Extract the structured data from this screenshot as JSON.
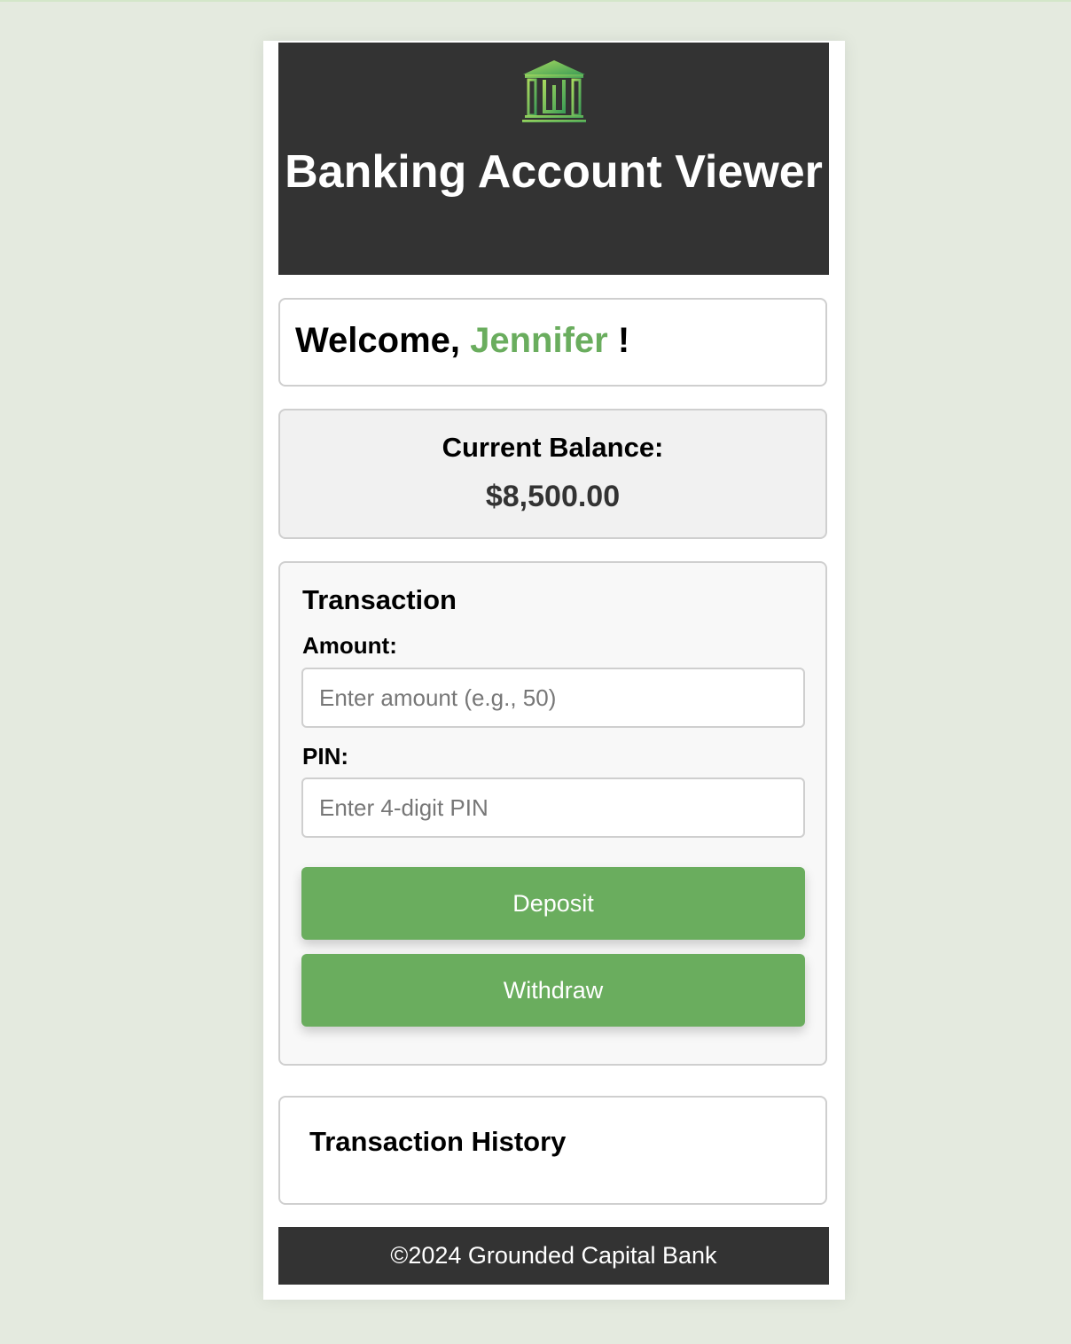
{
  "header": {
    "logo_icon": "bank-building-icon",
    "title": "Banking Account Viewer"
  },
  "welcome": {
    "prefix": "Welcome,",
    "name": "Jennifer",
    "suffix": "!"
  },
  "balance": {
    "label": "Current Balance:",
    "value": "$8,500.00"
  },
  "transaction": {
    "heading": "Transaction",
    "amount_label": "Amount:",
    "amount_placeholder": "Enter amount (e.g., 50)",
    "amount_value": "",
    "pin_label": "PIN:",
    "pin_placeholder": "Enter 4-digit PIN",
    "pin_value": "",
    "deposit_label": "Deposit",
    "withdraw_label": "Withdraw"
  },
  "history": {
    "heading": "Transaction History"
  },
  "footer": {
    "text": "©2024 Grounded Capital Bank"
  },
  "colors": {
    "accent": "#6aad5e",
    "header_bg": "#333333",
    "page_bg": "#e4eadf"
  }
}
